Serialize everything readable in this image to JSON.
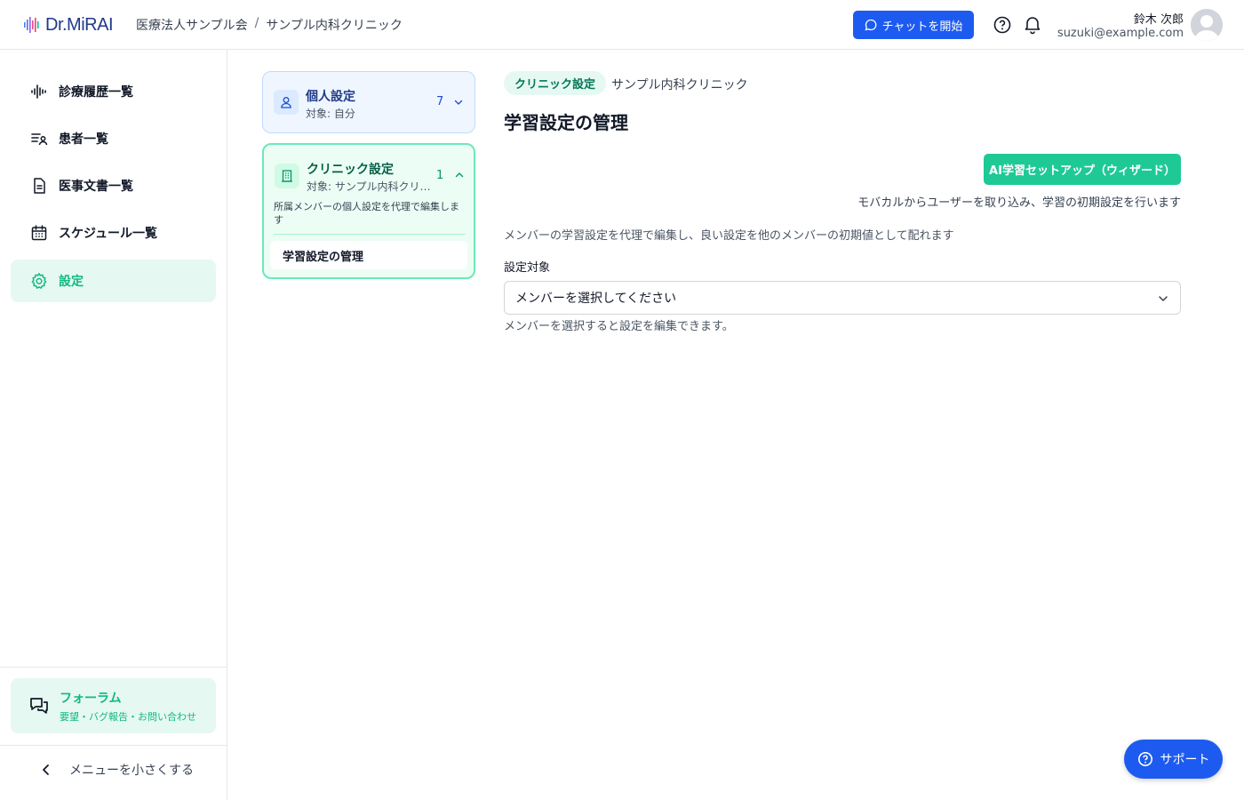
{
  "header": {
    "logo_text": "Dr.MiRAI",
    "breadcrumb": [
      "医療法人サンプル会",
      "/",
      "サンプル内科クリニック"
    ],
    "chat_button": "チャットを開始",
    "user_name": "鈴木 次郎",
    "user_email": "suzuki@example.com"
  },
  "sidebar": {
    "items": [
      {
        "label": "診療履歴一覧",
        "icon": "waveform-icon"
      },
      {
        "label": "患者一覧",
        "icon": "patient-list-icon"
      },
      {
        "label": "医事文書一覧",
        "icon": "document-icon"
      },
      {
        "label": "スケジュール一覧",
        "icon": "calendar-icon"
      },
      {
        "label": "設定",
        "icon": "gear-icon"
      }
    ],
    "forum": {
      "title": "フォーラム",
      "subtitle": "要望・バグ報告・お問い合わせ"
    },
    "collapse_label": "メニューを小さくする"
  },
  "settings_groups": {
    "personal": {
      "title": "個人設定",
      "target": "対象: 自分",
      "count": "7"
    },
    "clinic": {
      "title": "クリニック設定",
      "target": "対象: サンプル内科クリニック",
      "count": "1",
      "description": "所属メンバーの個人設定を代理で編集します",
      "items": [
        "学習設定の管理"
      ]
    }
  },
  "main": {
    "tag": "クリニック設定",
    "tag_target": "サンプル内科クリニック",
    "title": "学習設定の管理",
    "ai_button": "AI学習セットアップ（ウィザード）",
    "ai_note": "モバカルからユーザーを取り込み、学習の初期設定を行います",
    "description": "メンバーの学習設定を代理で編集し、良い設定を他のメンバーの初期値として配れます",
    "field_label": "設定対象",
    "select_value": "メンバーを選択してください",
    "hint": "メンバーを選択すると設定を編集できます。"
  },
  "support_button": "サポート",
  "colors": {
    "brand_blue": "#1d5bf0",
    "brand_green": "#1ec995",
    "active_bg": "#e6f8f2"
  }
}
